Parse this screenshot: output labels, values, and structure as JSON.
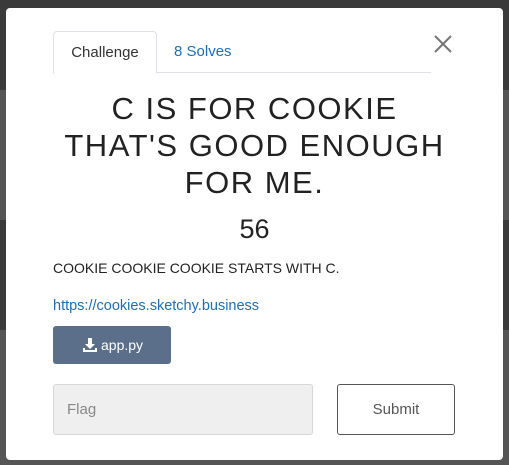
{
  "tabs": {
    "challenge": "Challenge",
    "solves": "8 Solves"
  },
  "challenge": {
    "title_line1": "C IS FOR COOKIE",
    "title_line2": "THAT'S GOOD ENOUGH",
    "title_line3": "FOR ME.",
    "points": "56",
    "description": "COOKIE COOKIE COOKIE STARTS WITH C.",
    "link": "https://cookies.sketchy.business",
    "file_label": "app.py"
  },
  "form": {
    "flag_placeholder": "Flag",
    "flag_value": "",
    "submit_label": "Submit"
  },
  "icons": {
    "close": "close-icon",
    "download": "download-icon"
  },
  "colors": {
    "link": "#1a6fb9",
    "file_button": "#5b6f8a"
  }
}
